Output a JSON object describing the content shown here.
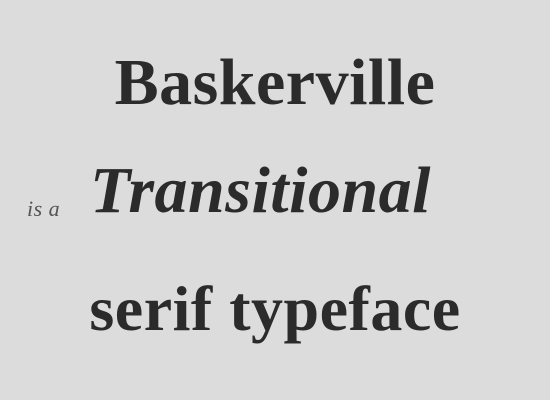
{
  "specimen": {
    "line1": "Baskerville",
    "line2_small": "is a",
    "line2_big": "Transitional",
    "line3": "serif typeface"
  },
  "colors": {
    "background": "#dcdcdc",
    "text": "#2b2b2b",
    "muted_text": "#555555"
  }
}
